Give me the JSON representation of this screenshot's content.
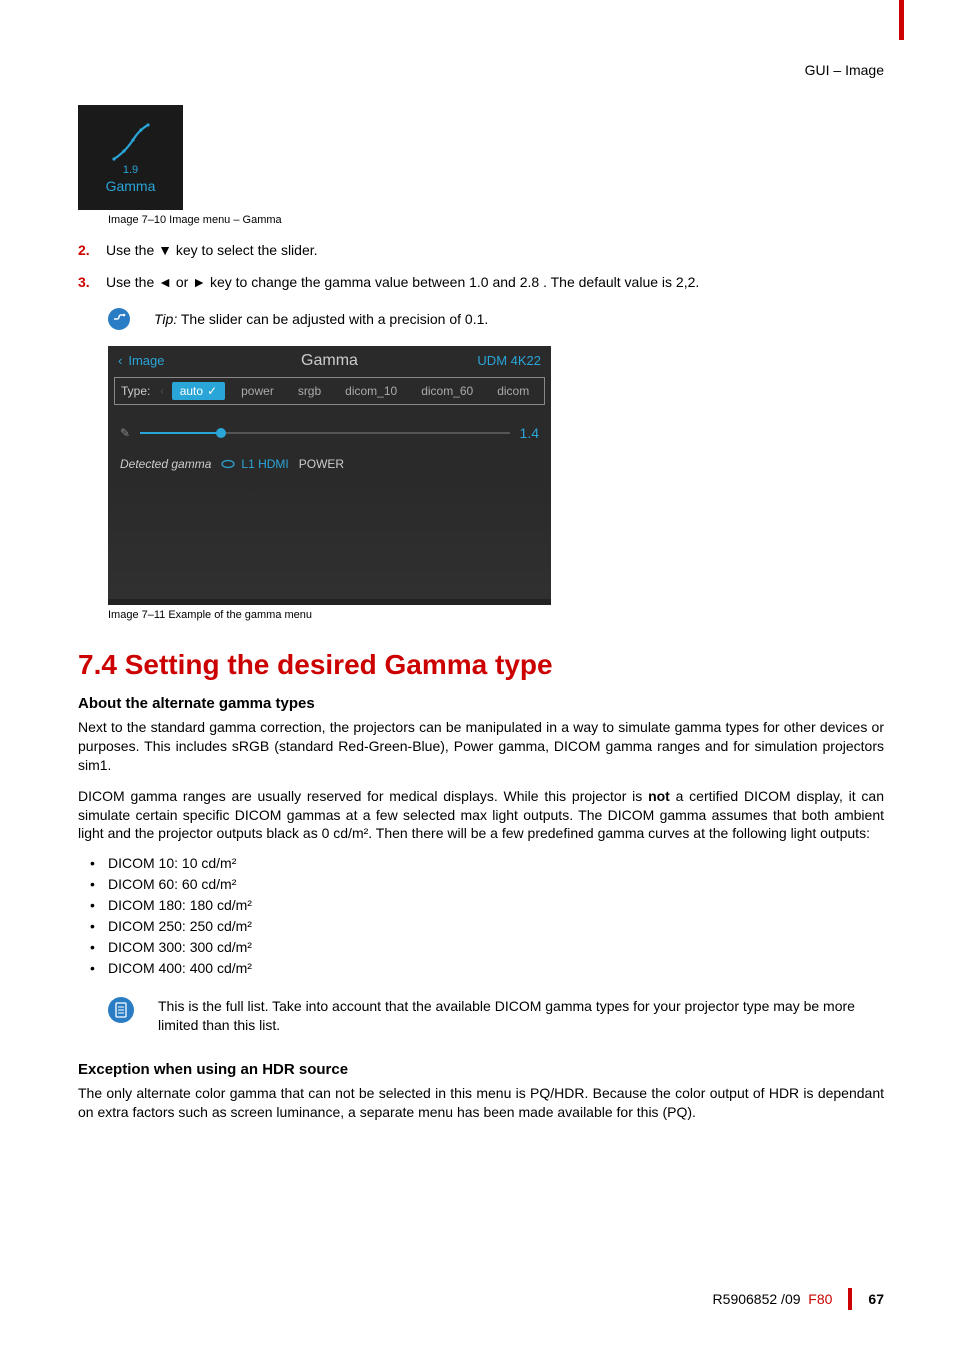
{
  "header": {
    "breadcrumb": "GUI – Image"
  },
  "gamma_icon": {
    "value": "1.9",
    "label": "Gamma",
    "caption": "Image 7–10  Image menu – Gamma"
  },
  "steps": {
    "s2_num": "2.",
    "s2_text": "Use the ▼ key to select the slider.",
    "s3_num": "3.",
    "s3_text": "Use the ◄ or ► key to change the gamma value between 1.0 and 2.8 . The default value is 2,2."
  },
  "tip": {
    "label": "Tip:",
    "text": " The slider can be adjusted with a precision of 0.1."
  },
  "gamma_menu": {
    "back": "Image",
    "title": "Gamma",
    "model": "UDM 4K22",
    "type_label": "Type:",
    "options": [
      "auto",
      "power",
      "srgb",
      "dicom_10",
      "dicom_60",
      "dicom"
    ],
    "selected_index": 0,
    "slider_value": "1.4",
    "detected_label": "Detected gamma",
    "detected_source": "L1 HDMI",
    "detected_mode": "POWER",
    "caption": "Image 7–11  Example of the gamma menu"
  },
  "section": {
    "h1": "7.4 Setting the desired Gamma type",
    "h2a": "About the alternate gamma types",
    "p1": "Next to the standard gamma correction, the projectors can be manipulated in a way to simulate gamma types for other devices or purposes. This includes sRGB (standard Red-Green-Blue), Power gamma, DICOM gamma ranges and for simulation projectors sim1.",
    "p2": "DICOM gamma ranges are usually reserved for medical displays. While this projector is not a certified DICOM display, it can simulate certain specific DICOM gammas at a few selected max light outputs. The DICOM gamma assumes that both ambient light and the projector outputs black as 0 cd/m². Then there will be a few predefined gamma curves at the following light outputs:",
    "bullets": [
      "DICOM 10: 10 cd/m²",
      "DICOM 60: 60 cd/m²",
      "DICOM 180: 180 cd/m²",
      "DICOM 250: 250 cd/m²",
      "DICOM 300: 300 cd/m²",
      "DICOM 400: 400 cd/m²"
    ],
    "note": "This is the full list. Take into account that the available DICOM gamma types for your projector type may be more limited than this list.",
    "h2b": "Exception when using an HDR source",
    "p3": "The only alternate color gamma that can not be selected in this menu is PQ/HDR. Because the color output of HDR is dependant on extra factors such as screen luminance, a separate menu has been made available for this (PQ)."
  },
  "footer": {
    "doc": "R5906852 /09",
    "model": "F80",
    "page": "67"
  }
}
